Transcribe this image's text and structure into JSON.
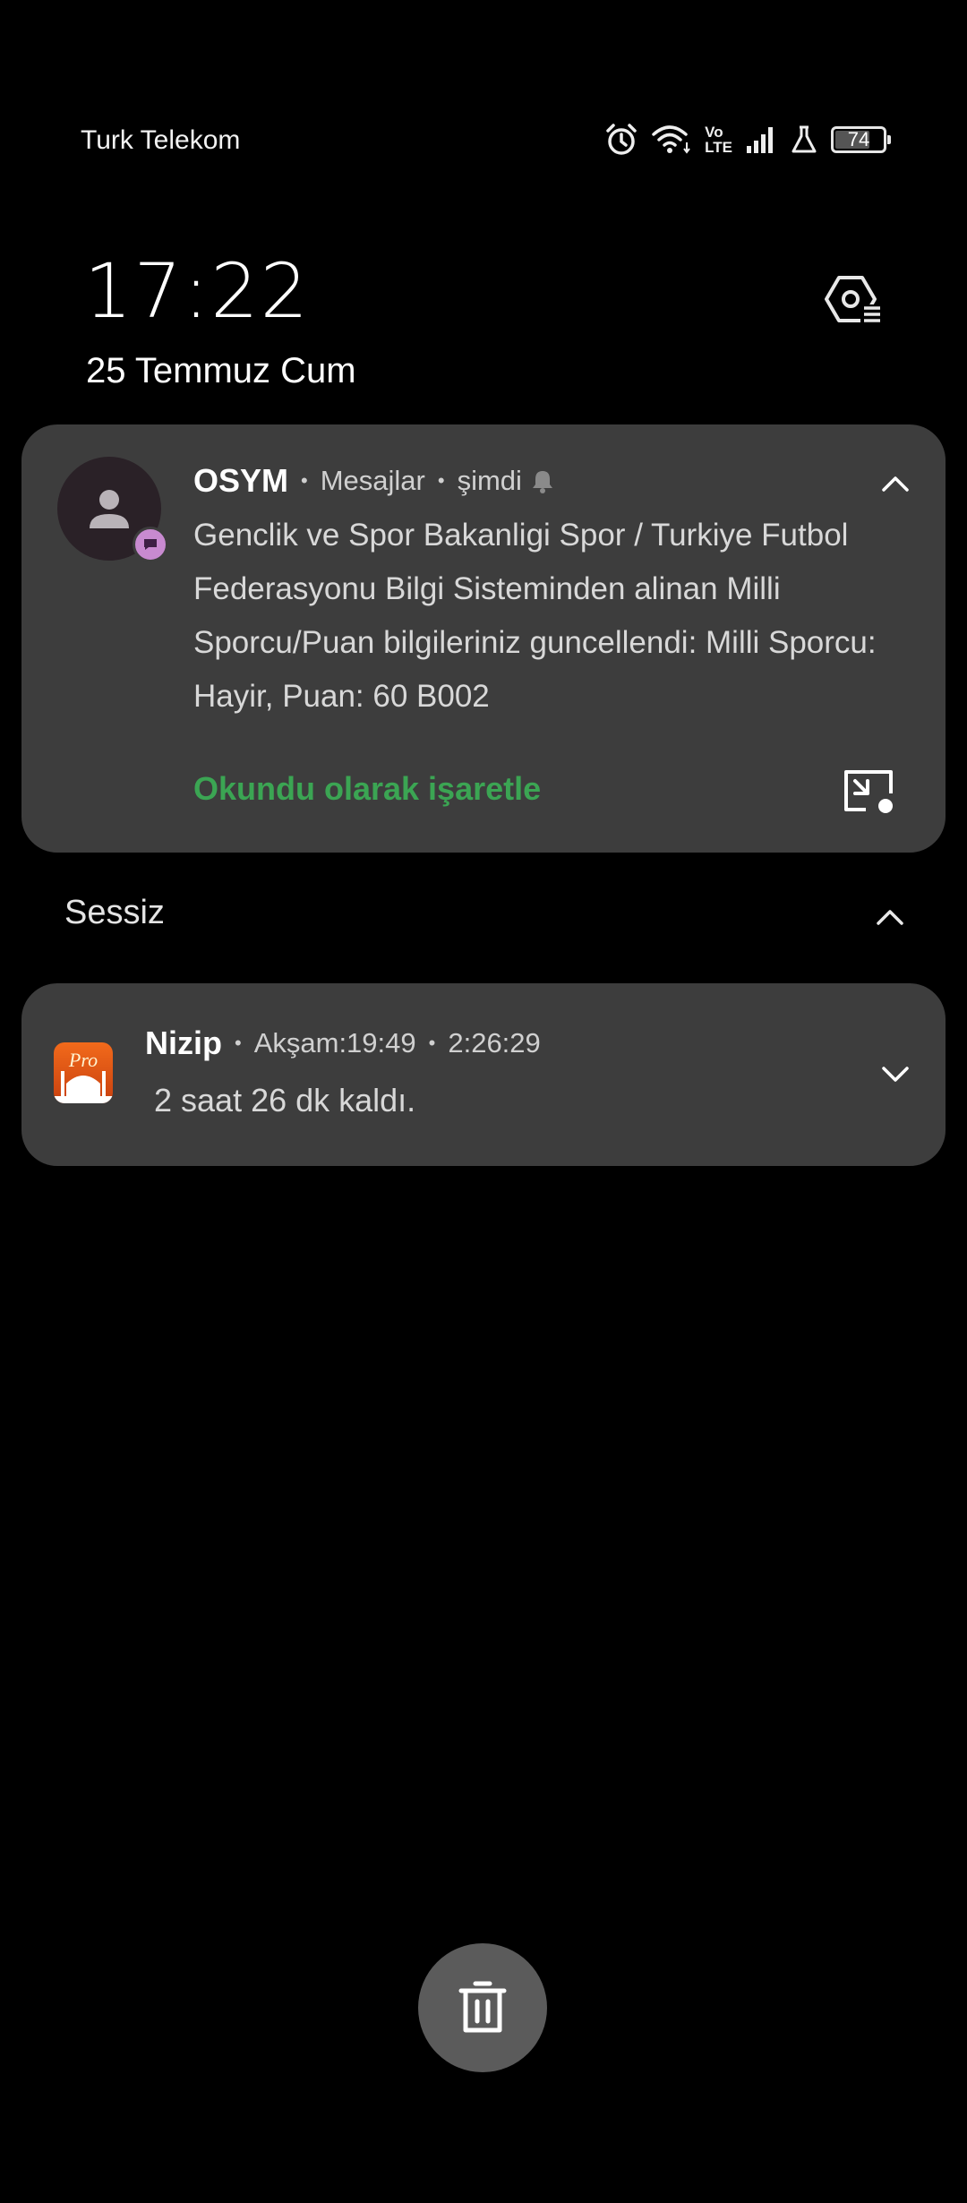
{
  "status_bar": {
    "carrier": "Turk Telekom",
    "battery": "74",
    "volte_top": "Vo",
    "volte_bottom": "LTE",
    "icons": [
      "alarm-icon",
      "wifi-icon",
      "volte-icon",
      "signal-icon",
      "lab-icon",
      "battery-icon"
    ]
  },
  "lockscreen": {
    "time": "17:22",
    "date": "25 Temmuz Cum"
  },
  "notifications": [
    {
      "app": "OSYM",
      "source": "Mesajlar",
      "time": "şimdi",
      "body": "Genclik ve Spor Bakanligi Spor / Turkiye Futbol Federasyonu Bilgi Sisteminden alinan Milli Sporcu/Puan bilgileriniz guncellendi: Milli Sporcu: Hayir, Puan: 60 B002",
      "action": "Okundu olarak işaretle"
    }
  ],
  "silent_section": {
    "label": "Sessiz",
    "notifications": [
      {
        "app": "Nizip",
        "subtitle": "Akşam:19:49",
        "time": "2:26:29",
        "body": "2 saat 26 dk kaldı."
      }
    ]
  },
  "colors": {
    "card": "#3d3d3d",
    "accent_green": "#3ba553",
    "badge_purple": "#c88ad0",
    "clear_button": "#5b5b5b"
  }
}
